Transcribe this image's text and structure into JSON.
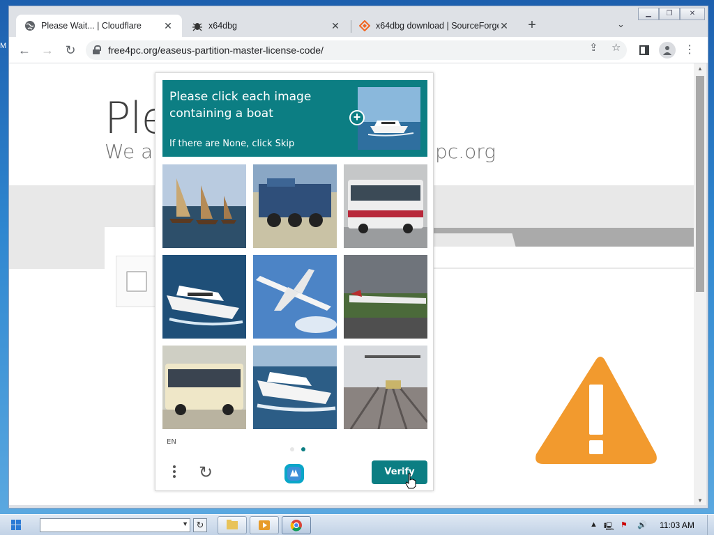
{
  "browser": {
    "tabs": [
      {
        "title": "Please Wait... | Cloudflare",
        "icon": "globe-icon"
      },
      {
        "title": "x64dbg",
        "icon": "bug-icon"
      },
      {
        "title": "x64dbg download | SourceForge.net",
        "icon": "sourceforge-icon"
      }
    ],
    "address": "free4pc.org/easeus-partition-master-license-code/"
  },
  "page": {
    "heading": "Ple",
    "subheading_left": "We ar",
    "subheading_right": "pc.org"
  },
  "captcha": {
    "prompt": "Please click each image containing a boat",
    "hint": "If there are None, click Skip",
    "language": "EN",
    "verify_label": "Verify",
    "accent_color": "#0c7e83",
    "images": [
      {
        "subject": "sailboats"
      },
      {
        "subject": "locomotive"
      },
      {
        "subject": "bus"
      },
      {
        "subject": "motor yacht"
      },
      {
        "subject": "airplane"
      },
      {
        "subject": "airplane on runway"
      },
      {
        "subject": "bus"
      },
      {
        "subject": "motor yacht"
      },
      {
        "subject": "train tracks"
      }
    ]
  },
  "taskbar": {
    "clock": "11:03 AM"
  },
  "desktop": {
    "edge_letter": "M"
  }
}
